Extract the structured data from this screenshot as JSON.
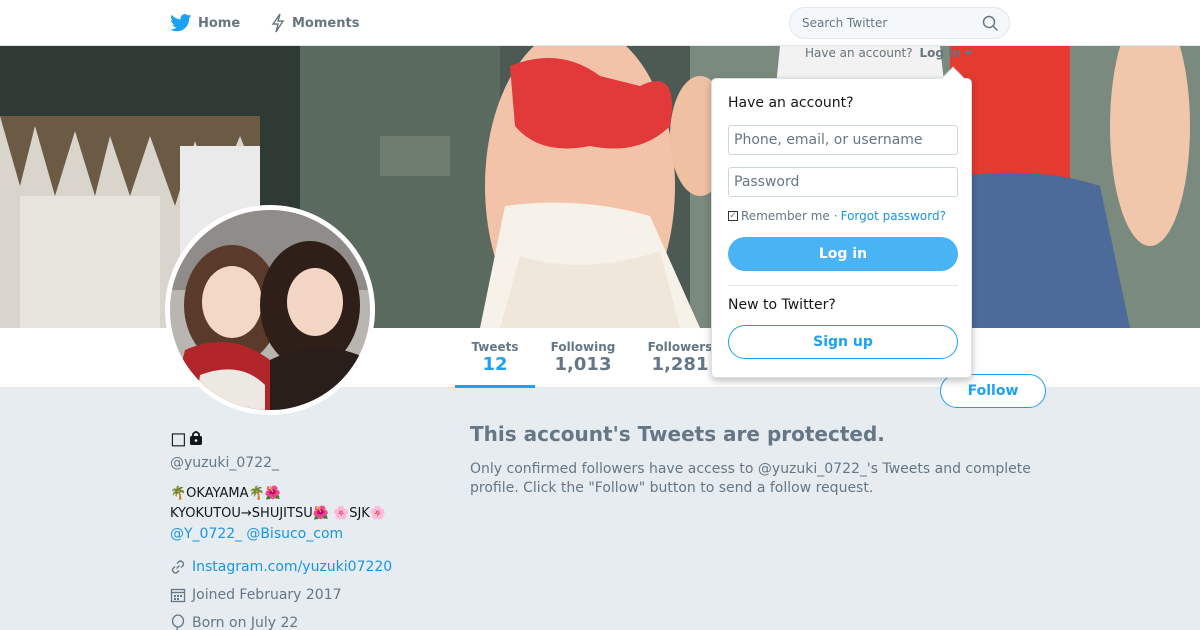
{
  "nav": {
    "home_label": "Home",
    "moments_label": "Moments",
    "search_placeholder": "Search Twitter"
  },
  "login_prompt": {
    "text": "Have an account?",
    "link": "Log in"
  },
  "login_dropdown": {
    "title": "Have an account?",
    "username_placeholder": "Phone, email, or username",
    "password_placeholder": "Password",
    "remember_label": "Remember me",
    "separator": "·",
    "forgot_label": "Forgot password?",
    "login_button": "Log in",
    "new_label": "New to Twitter?",
    "signup_button": "Sign up"
  },
  "profile_nav": {
    "stats": [
      {
        "label": "Tweets",
        "value": "12"
      },
      {
        "label": "Following",
        "value": "1,013"
      },
      {
        "label": "Followers",
        "value": "1,281"
      }
    ],
    "follow_button": "Follow"
  },
  "profile": {
    "display_name": "◻",
    "handle": "@yuzuki_0722_",
    "bio_line1": "🌴OKAYAMA🌴🌺",
    "bio_line2": "KYOKUTOU→SHUJITSU🌺 🌸SJK🌸",
    "bio_mention1": "@Y_0722_",
    "bio_mention2": "@Bisuco_com",
    "website": "Instagram.com/yuzuki07220",
    "joined": "Joined February 2017",
    "born": "Born on July 22"
  },
  "protected": {
    "title": "This account's Tweets are protected.",
    "body": "Only confirmed followers have access to @yuzuki_0722_'s Tweets and complete profile. Click the \"Follow\" button to send a follow request."
  },
  "colors": {
    "accent": "#1da1f2",
    "link": "#1b95e0",
    "login_button": "#4ab3f4",
    "background": "#e6ecf0"
  },
  "icons": [
    "twitter-bird-icon",
    "moments-bolt-icon",
    "search-icon",
    "lock-icon",
    "link-icon",
    "calendar-icon",
    "balloon-icon",
    "caret-down-icon"
  ]
}
